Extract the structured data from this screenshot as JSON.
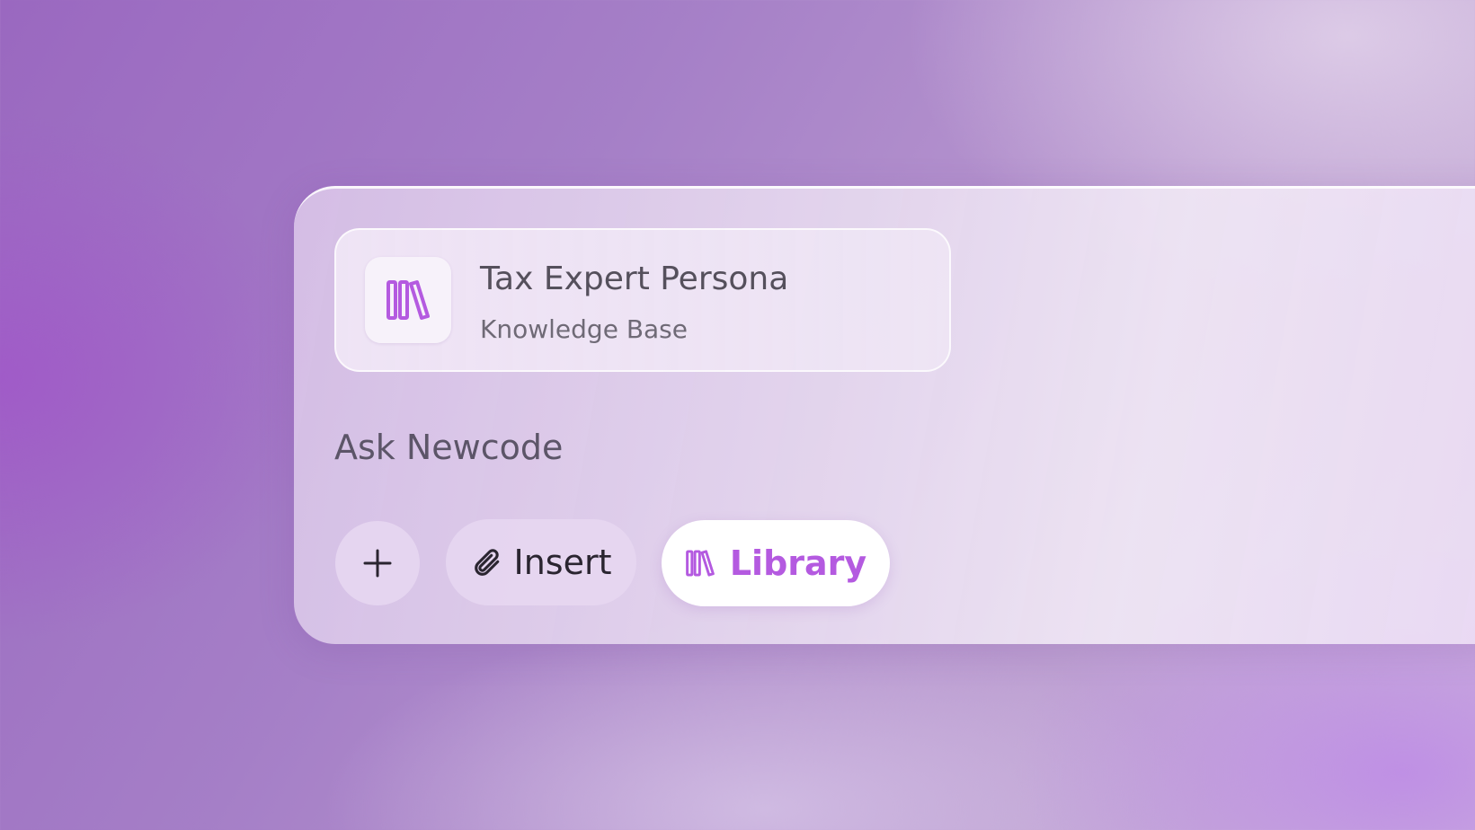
{
  "knowledge_card": {
    "icon": "library-books-icon",
    "title": "Tax Expert Persona",
    "subtitle": "Knowledge Base"
  },
  "prompt": {
    "placeholder": "Ask Newcode"
  },
  "actions": {
    "add_icon": "plus-icon",
    "insert": {
      "icon": "paperclip-icon",
      "label": "Insert"
    },
    "library": {
      "icon": "library-books-icon",
      "label": "Library"
    }
  },
  "colors": {
    "accent": "#b45ae0",
    "text_primary": "#2a2530",
    "text_muted": "#6f6a76"
  }
}
